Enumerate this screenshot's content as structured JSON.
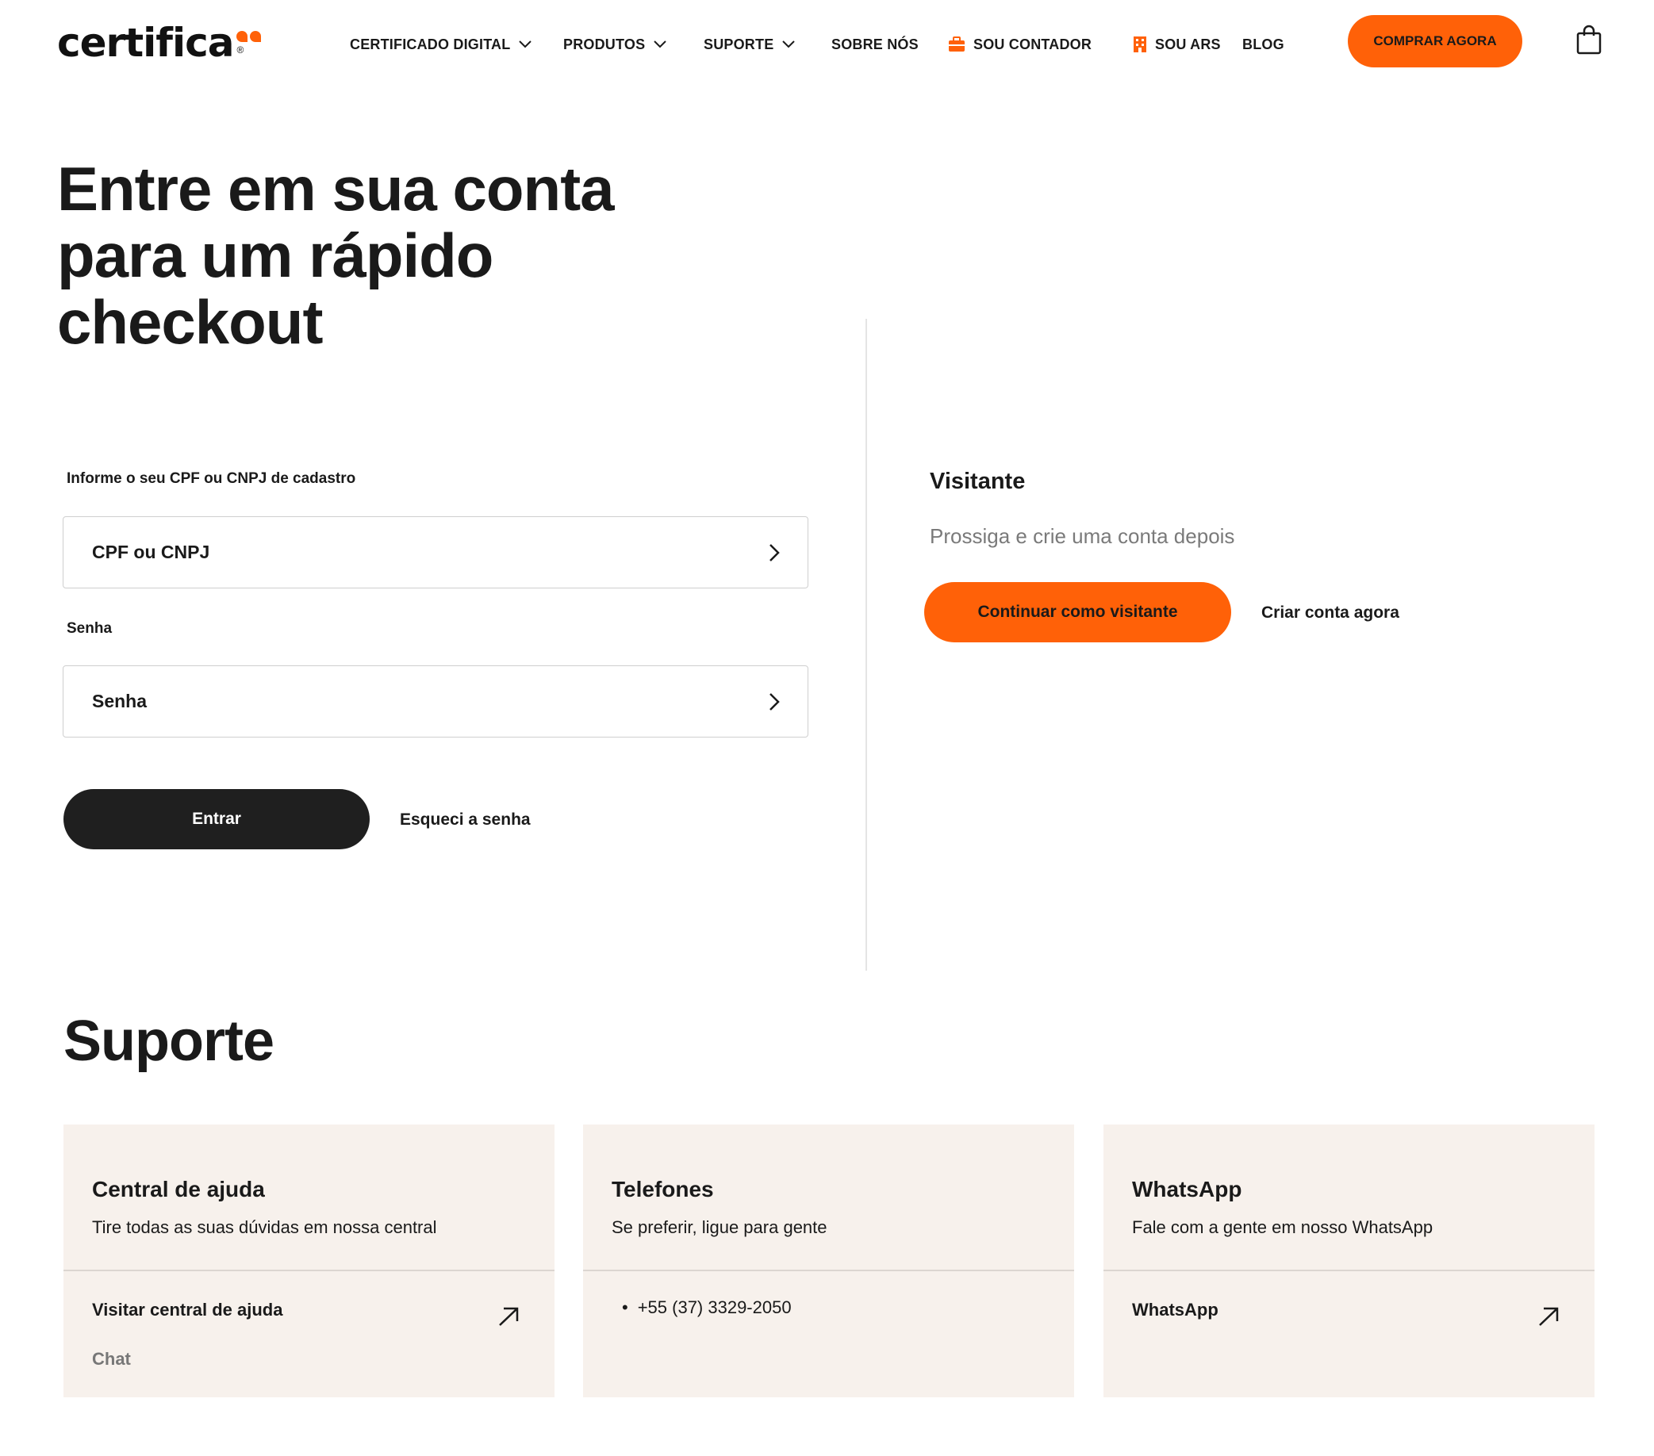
{
  "header": {
    "logo_text": "certifica",
    "logo_reg": "®",
    "nav": [
      {
        "label": "CERTIFICADO DIGITAL",
        "has_dropdown": true
      },
      {
        "label": "PRODUTOS",
        "has_dropdown": true
      },
      {
        "label": "SUPORTE",
        "has_dropdown": true
      },
      {
        "label": "SOBRE NÓS"
      },
      {
        "label": "SOU CONTADOR",
        "icon": "briefcase-icon"
      },
      {
        "label": "SOU ARS",
        "icon": "building-icon"
      },
      {
        "label": "BLOG"
      }
    ],
    "buy_label": "COMPRAR AGORA",
    "cart_icon": "shopping-bag-icon"
  },
  "colors": {
    "accent": "#ff6108",
    "dark_button": "#1f1f1f",
    "card_bg": "#f7f1ec",
    "muted_text": "#7a7a7a"
  },
  "login": {
    "title": "Entre em sua conta para um rápido checkout",
    "document_label": "Informe o seu CPF ou CNPJ de cadastro",
    "document_placeholder": "CPF ou CNPJ",
    "password_label": "Senha",
    "password_placeholder": "Senha",
    "submit_label": "Entrar",
    "forgot_label": "Esqueci a senha"
  },
  "visitor": {
    "title": "Visitante",
    "text": "Prossiga e crie uma conta depois",
    "continue_label": "Continuar como visitante",
    "create_label": "Criar conta agora"
  },
  "support": {
    "title": "Suporte",
    "cards": [
      {
        "title": "Central de ajuda",
        "subtitle": "Tire todas as suas dúvidas em nossa central",
        "link": "Visitar central de ajuda",
        "link2": "Chat"
      },
      {
        "title": "Telefones",
        "subtitle": "Se preferir, ligue para gente",
        "phone": "+55 (37) 3329-2050"
      },
      {
        "title": "WhatsApp",
        "subtitle": "Fale com a gente em nosso WhatsApp",
        "link": "WhatsApp"
      }
    ]
  }
}
